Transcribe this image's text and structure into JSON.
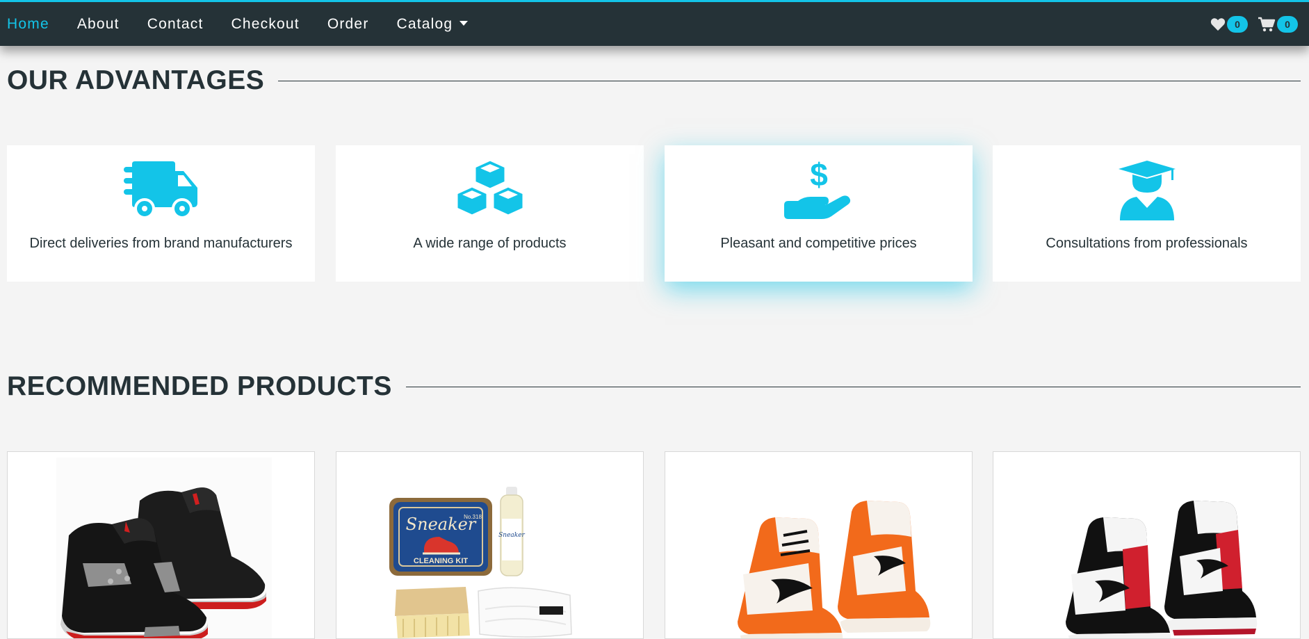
{
  "nav": {
    "links": [
      "Home",
      "About",
      "Contact",
      "Checkout",
      "Order",
      "Catalog"
    ],
    "active": "Home",
    "wishlist_count": "0",
    "cart_count": "0"
  },
  "advantages": {
    "heading": "OUR ADVANTAGES",
    "items": [
      {
        "icon": "delivery-truck-icon",
        "text": "Direct deliveries from brand manufacturers"
      },
      {
        "icon": "boxes-icon",
        "text": "A wide range of products"
      },
      {
        "icon": "hand-dollar-icon",
        "text": "Pleasant and competitive prices"
      },
      {
        "icon": "graduate-user-icon",
        "text": "Consultations from professionals"
      }
    ]
  },
  "recommended": {
    "heading": "RECOMMENDED PRODUCTS",
    "products": [
      {
        "image": "black-red-grey-sneakers"
      },
      {
        "image": "sneaker-cleaning-kit",
        "label": "Sneaker",
        "sublabel": "CLEANING KIT",
        "code": "No.318",
        "bottle_label": "Sneaker"
      },
      {
        "image": "orange-white-black-high-top-sneakers"
      },
      {
        "image": "red-white-black-high-top-sneakers"
      }
    ]
  },
  "colors": {
    "navbar": "#253237",
    "accent": "#13c4e8",
    "background": "#f4f4f4",
    "text": "#253237"
  }
}
